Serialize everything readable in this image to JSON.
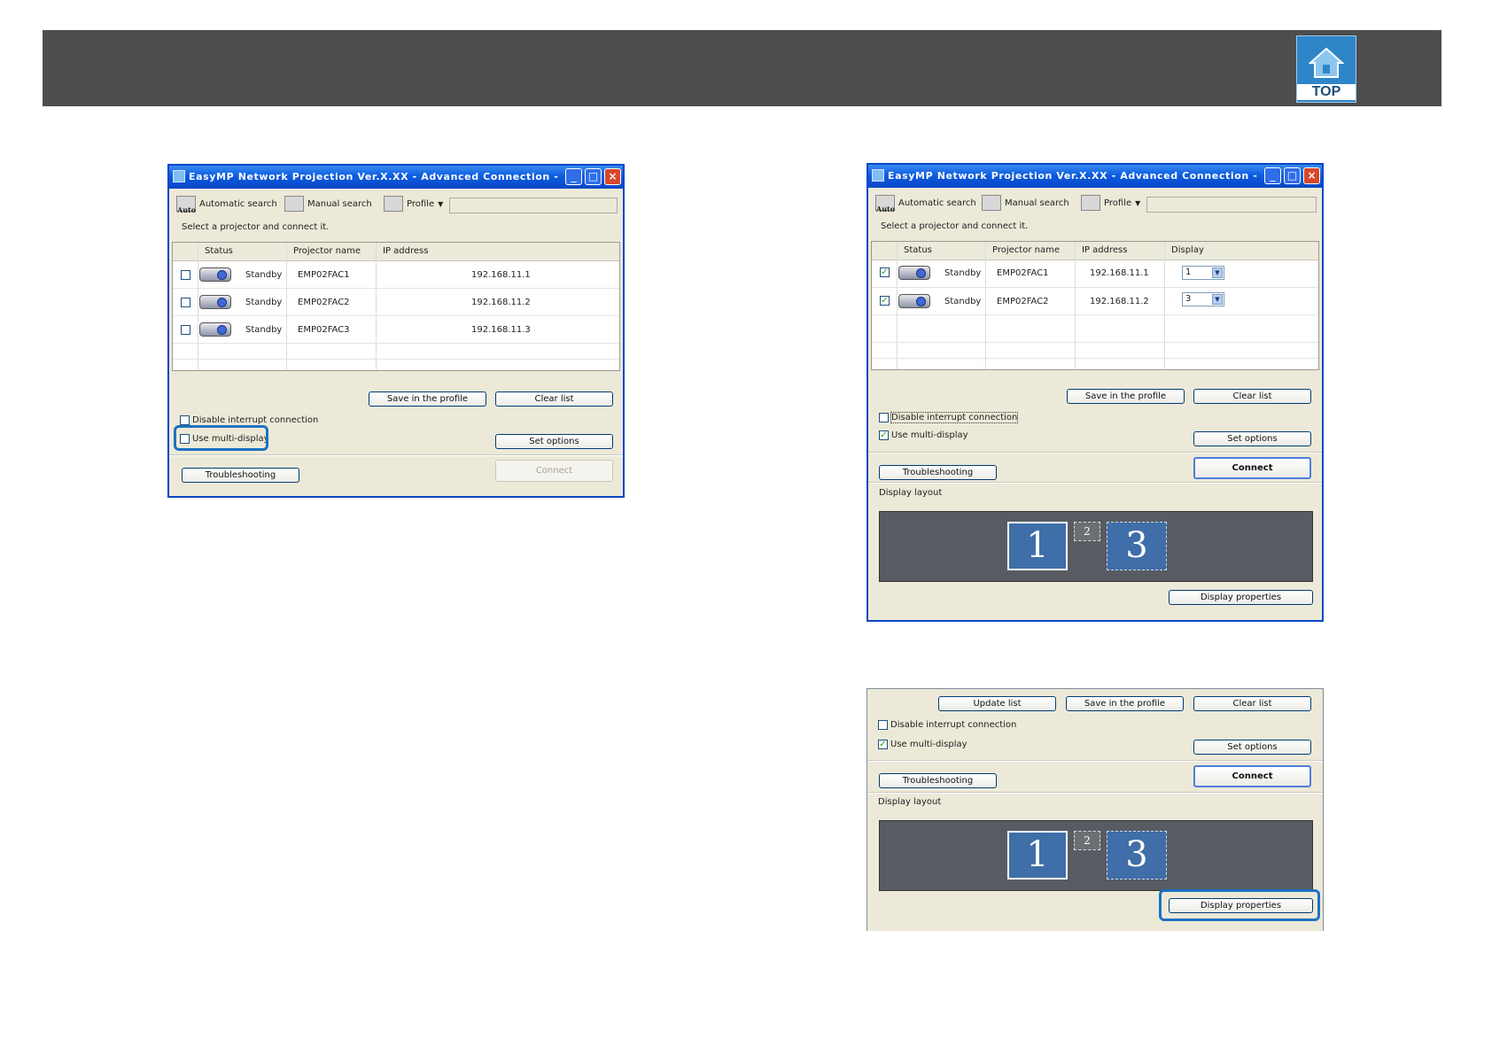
{
  "header": {
    "logo_text": "TOP"
  },
  "common": {
    "window_title": "EasyMP Network Projection Ver.X.XX - Advanced Connection -",
    "toolbar": {
      "auto_badge": "Auto",
      "automatic_search": "Automatic search",
      "manual_search": "Manual search",
      "profile": "Profile"
    },
    "hint": "Select a projector and connect it.",
    "columns": {
      "status": "Status",
      "projector_name": "Projector name",
      "ip_address": "IP address",
      "display": "Display"
    },
    "buttons": {
      "update_list": "Update list",
      "save_profile": "Save in the profile",
      "clear_list": "Clear list",
      "set_options": "Set options",
      "troubleshooting": "Troubleshooting",
      "connect": "Connect",
      "display_properties": "Display properties"
    },
    "checkboxes": {
      "disable_interrupt": "Disable interrupt connection",
      "use_multi_display": "Use multi-display"
    },
    "display_layout_label": "Display layout"
  },
  "window1": {
    "rows": [
      {
        "checked": false,
        "status": "Standby",
        "name": "EMP02FAC1",
        "ip": "192.168.11.1"
      },
      {
        "checked": false,
        "status": "Standby",
        "name": "EMP02FAC2",
        "ip": "192.168.11.2"
      },
      {
        "checked": false,
        "status": "Standby",
        "name": "EMP02FAC3",
        "ip": "192.168.11.3"
      }
    ],
    "disable_interrupt_checked": false,
    "use_multi_display_checked": false,
    "connect_enabled": false
  },
  "window2": {
    "rows": [
      {
        "checked": true,
        "status": "Standby",
        "name": "EMP02FAC1",
        "ip": "192.168.11.1",
        "display": "1"
      },
      {
        "checked": true,
        "status": "Standby",
        "name": "EMP02FAC2",
        "ip": "192.168.11.2",
        "display": "3"
      }
    ],
    "disable_interrupt_checked": false,
    "use_multi_display_checked": true,
    "monitors": {
      "m1": "1",
      "m2": "2",
      "m3": "3"
    }
  },
  "window3": {
    "disable_interrupt_checked": false,
    "use_multi_display_checked": true,
    "monitors": {
      "m1": "1",
      "m2": "2",
      "m3": "3"
    }
  },
  "colors": {
    "banner": "#4d4d4d",
    "highlight": "#1d72c2",
    "titlebar": "#0d5ce0",
    "monitor": "#3f6ea8"
  }
}
